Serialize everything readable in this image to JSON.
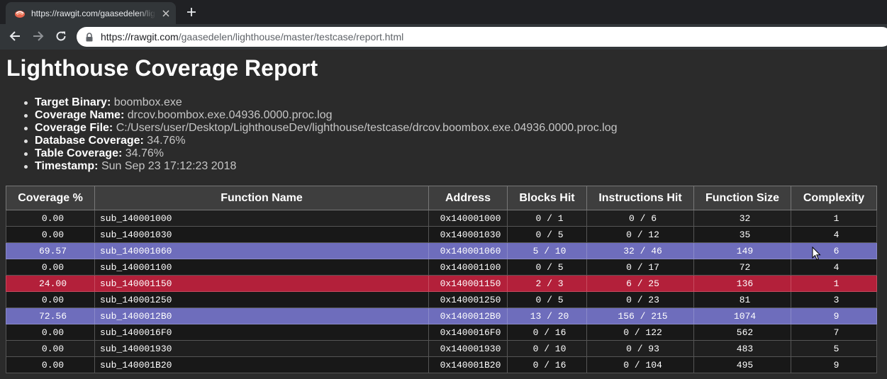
{
  "browser": {
    "tab_title": "https://rawgit.com/gaasedelen/lighthouse/master/testcase/report.html",
    "url_host": "https://rawgit.com",
    "url_path": "/gaasedelen/lighthouse/master/testcase/report.html",
    "icons": {
      "favicon": "rawgit-favicon",
      "close": "close-icon",
      "new_tab": "plus-icon",
      "back": "arrow-left-icon",
      "forward": "arrow-right-icon",
      "reload": "reload-icon",
      "secure": "lock-icon"
    }
  },
  "report": {
    "title": "Lighthouse Coverage Report",
    "meta": [
      {
        "key": "Target Binary:",
        "value": "boombox.exe"
      },
      {
        "key": "Coverage Name:",
        "value": "drcov.boombox.exe.04936.0000.proc.log"
      },
      {
        "key": "Coverage File:",
        "value": "C:/Users/user/Desktop/LighthouseDev/lighthouse/testcase/drcov.boombox.exe.04936.0000.proc.log"
      },
      {
        "key": "Database Coverage:",
        "value": "34.76%"
      },
      {
        "key": "Table Coverage:",
        "value": "34.76%"
      },
      {
        "key": "Timestamp:",
        "value": "Sun Sep 23 17:12:23 2018"
      }
    ],
    "columns": [
      "Coverage %",
      "Function Name",
      "Address",
      "Blocks Hit",
      "Instructions Hit",
      "Function Size",
      "Complexity"
    ],
    "rows": [
      {
        "coverage": "0.00",
        "name": "sub_140001000",
        "address": "0x140001000",
        "blocks": "0 / 1",
        "instructions": "0 / 6",
        "size": "32",
        "complexity": "1",
        "highlight": ""
      },
      {
        "coverage": "0.00",
        "name": "sub_140001030",
        "address": "0x140001030",
        "blocks": "0 / 5",
        "instructions": "0 / 12",
        "size": "35",
        "complexity": "4",
        "highlight": ""
      },
      {
        "coverage": "69.57",
        "name": "sub_140001060",
        "address": "0x140001060",
        "blocks": "5 / 10",
        "instructions": "32 / 46",
        "size": "149",
        "complexity": "6",
        "highlight": "blue"
      },
      {
        "coverage": "0.00",
        "name": "sub_140001100",
        "address": "0x140001100",
        "blocks": "0 / 5",
        "instructions": "0 / 17",
        "size": "72",
        "complexity": "4",
        "highlight": ""
      },
      {
        "coverage": "24.00",
        "name": "sub_140001150",
        "address": "0x140001150",
        "blocks": "2 / 3",
        "instructions": "6 / 25",
        "size": "136",
        "complexity": "1",
        "highlight": "red"
      },
      {
        "coverage": "0.00",
        "name": "sub_140001250",
        "address": "0x140001250",
        "blocks": "0 / 5",
        "instructions": "0 / 23",
        "size": "81",
        "complexity": "3",
        "highlight": ""
      },
      {
        "coverage": "72.56",
        "name": "sub_1400012B0",
        "address": "0x1400012B0",
        "blocks": "13 / 20",
        "instructions": "156 / 215",
        "size": "1074",
        "complexity": "9",
        "highlight": "blue"
      },
      {
        "coverage": "0.00",
        "name": "sub_1400016F0",
        "address": "0x1400016F0",
        "blocks": "0 / 16",
        "instructions": "0 / 122",
        "size": "562",
        "complexity": "7",
        "highlight": ""
      },
      {
        "coverage": "0.00",
        "name": "sub_140001930",
        "address": "0x140001930",
        "blocks": "0 / 10",
        "instructions": "0 / 93",
        "size": "483",
        "complexity": "5",
        "highlight": ""
      },
      {
        "coverage": "0.00",
        "name": "sub_140001B20",
        "address": "0x140001B20",
        "blocks": "0 / 16",
        "instructions": "0 / 104",
        "size": "495",
        "complexity": "9",
        "highlight": ""
      }
    ]
  },
  "colors": {
    "page_bg": "#2b2b2b",
    "header_bg": "#3e3e3e",
    "row_bg": "#1f1f1f",
    "row_alt_bg": "#181818",
    "highlight_blue": "#6e6dbc",
    "highlight_red": "#b3203a"
  }
}
